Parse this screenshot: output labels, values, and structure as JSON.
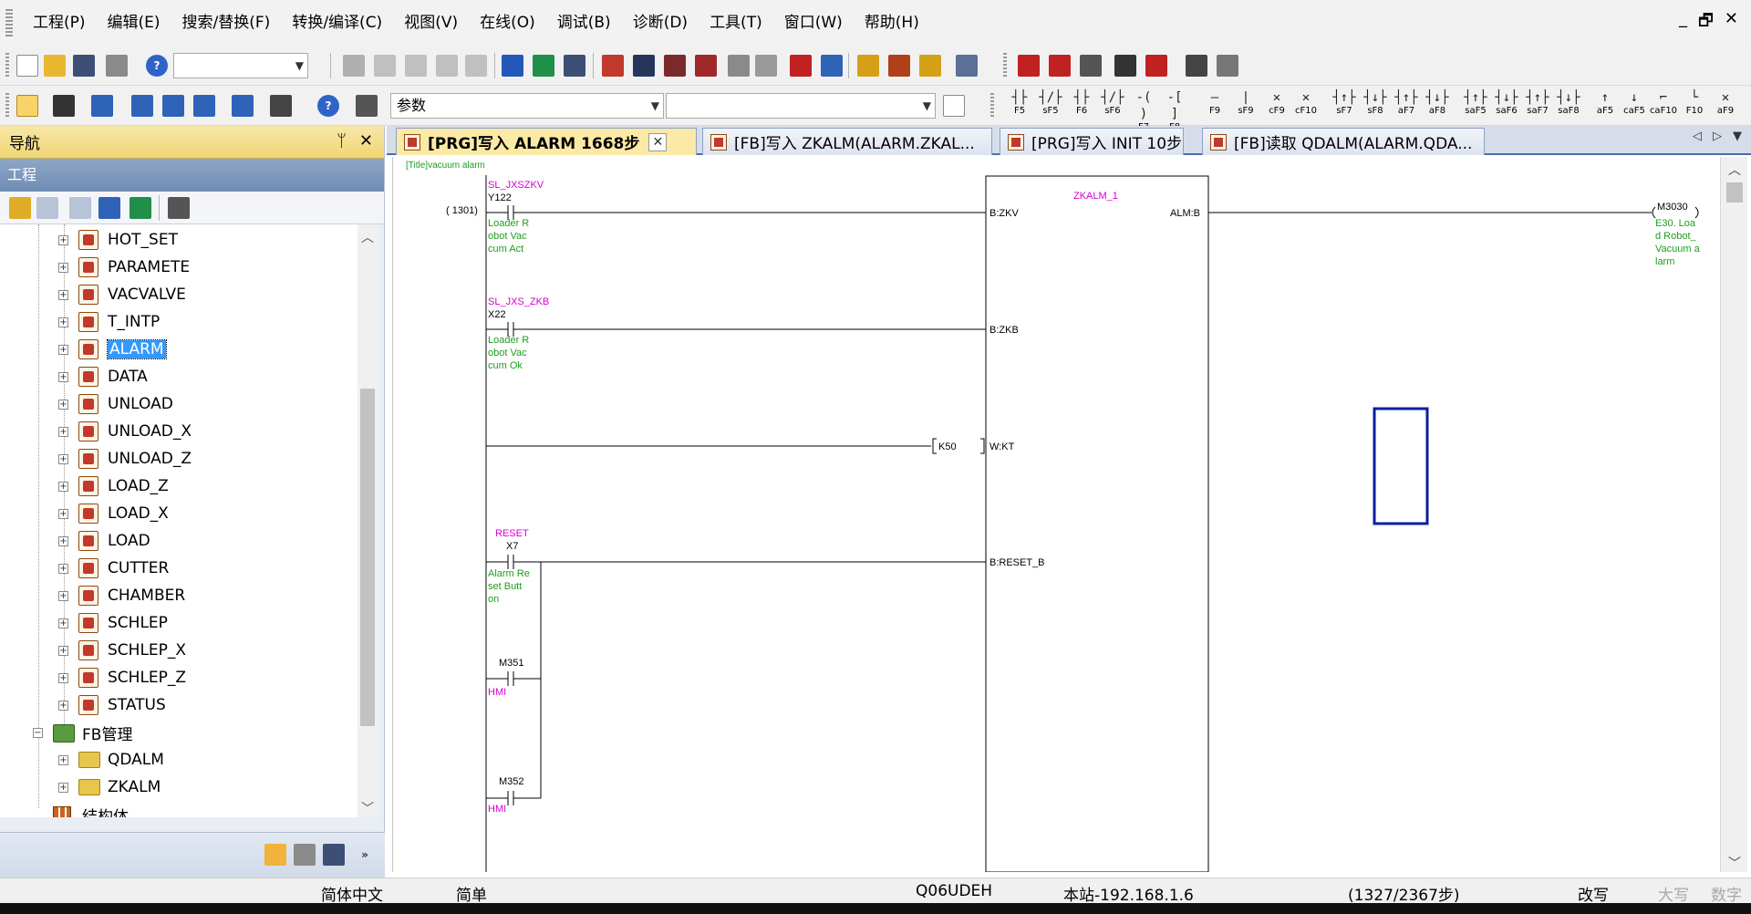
{
  "menu": {
    "items": [
      "工程(P)",
      "编辑(E)",
      "搜索/替换(F)",
      "转换/编译(C)",
      "视图(V)",
      "在线(O)",
      "调试(B)",
      "诊断(D)",
      "工具(T)",
      "窗口(W)",
      "帮助(H)"
    ],
    "window_controls": [
      "_",
      "🗗",
      "✕"
    ]
  },
  "toolbar": {
    "device_combo_value": "参数",
    "fkeys": [
      {
        "sym": "┤├",
        "label": "F5"
      },
      {
        "sym": "┤/├",
        "label": "sF5"
      },
      {
        "sym": "┤├",
        "label": "F6"
      },
      {
        "sym": "┤/├",
        "label": "sF6"
      },
      {
        "sym": "-( )",
        "label": "F7"
      },
      {
        "sym": "-[ ]",
        "label": "F8"
      },
      {
        "sym": "—",
        "label": "F9"
      },
      {
        "sym": "|",
        "label": "sF9"
      },
      {
        "sym": "✕",
        "label": "cF9"
      },
      {
        "sym": "✕",
        "label": "cF10"
      },
      {
        "sym": "┤↑├",
        "label": "sF7"
      },
      {
        "sym": "┤↓├",
        "label": "sF8"
      },
      {
        "sym": "┤↑├",
        "label": "aF7"
      },
      {
        "sym": "┤↓├",
        "label": "aF8"
      },
      {
        "sym": "┤↑├",
        "label": "saF5"
      },
      {
        "sym": "┤↓├",
        "label": "saF6"
      },
      {
        "sym": "┤↑├",
        "label": "saF7"
      },
      {
        "sym": "┤↓├",
        "label": "saF8"
      },
      {
        "sym": "↑",
        "label": "aF5"
      },
      {
        "sym": "↓",
        "label": "caF5"
      },
      {
        "sym": "⌐",
        "label": "caF10"
      },
      {
        "sym": "└",
        "label": "F10"
      },
      {
        "sym": "✕",
        "label": "aF9"
      }
    ]
  },
  "nav": {
    "title": "导航",
    "pin": "ᛘ",
    "close": "✕",
    "section": "工程",
    "tree": [
      {
        "label": "HOT_SET",
        "type": "prog",
        "level": 2,
        "expander": "+"
      },
      {
        "label": "PARAMETE",
        "type": "prog",
        "level": 2,
        "expander": "+"
      },
      {
        "label": "VACVALVE",
        "type": "prog",
        "level": 2,
        "expander": "+"
      },
      {
        "label": "T_INTP",
        "type": "prog",
        "level": 2,
        "expander": "+"
      },
      {
        "label": "ALARM",
        "type": "prog",
        "level": 2,
        "expander": "+",
        "selected": true
      },
      {
        "label": "DATA",
        "type": "prog",
        "level": 2,
        "expander": "+"
      },
      {
        "label": "UNLOAD",
        "type": "prog",
        "level": 2,
        "expander": "+"
      },
      {
        "label": "UNLOAD_X",
        "type": "prog",
        "level": 2,
        "expander": "+"
      },
      {
        "label": "UNLOAD_Z",
        "type": "prog",
        "level": 2,
        "expander": "+"
      },
      {
        "label": "LOAD_Z",
        "type": "prog",
        "level": 2,
        "expander": "+"
      },
      {
        "label": "LOAD_X",
        "type": "prog",
        "level": 2,
        "expander": "+"
      },
      {
        "label": "LOAD",
        "type": "prog",
        "level": 2,
        "expander": "+"
      },
      {
        "label": "CUTTER",
        "type": "prog",
        "level": 2,
        "expander": "+"
      },
      {
        "label": "CHAMBER",
        "type": "prog",
        "level": 2,
        "expander": "+"
      },
      {
        "label": "SCHLEP",
        "type": "prog",
        "level": 2,
        "expander": "+"
      },
      {
        "label": "SCHLEP_X",
        "type": "prog",
        "level": 2,
        "expander": "+"
      },
      {
        "label": "SCHLEP_Z",
        "type": "prog",
        "level": 2,
        "expander": "+"
      },
      {
        "label": "STATUS",
        "type": "prog",
        "level": 2,
        "expander": "+"
      },
      {
        "label": "FB管理",
        "type": "fbmgr",
        "level": 1,
        "expander": "−"
      },
      {
        "label": "QDALM",
        "type": "folder",
        "level": 2,
        "expander": "+"
      },
      {
        "label": "ZKALM",
        "type": "folder",
        "level": 2,
        "expander": "+"
      },
      {
        "label": "结构体",
        "type": "struct",
        "level": 1,
        "expander": ""
      }
    ]
  },
  "tabs": [
    {
      "label": "[PRG]写入 ALARM 1668步",
      "active": true,
      "close": "✕"
    },
    {
      "label": "[FB]写入 ZKALM(ALARM.ZKAL...",
      "active": false
    },
    {
      "label": "[PRG]写入 INIT 10步",
      "active": false
    },
    {
      "label": "[FB]读取 QDALM(ALARM.QDA...",
      "active": false
    }
  ],
  "ladder": {
    "title": "[Title]vacuum alarm",
    "step": "( 1301)",
    "contacts": [
      {
        "label": "SL_JXSZKV",
        "device": "Y122",
        "comment": [
          "Loader R",
          "obot Vac",
          "cum Act"
        ],
        "pin": "B:ZKV"
      },
      {
        "label": "SL_JXS_ZKB",
        "device": "X22",
        "comment": [
          "Loader R",
          "obot Vac",
          "cum Ok"
        ],
        "pin": "B:ZKB"
      },
      {
        "label": "RESET",
        "device": "X7",
        "comment": [
          "Alarm Re",
          "set Butt",
          "on"
        ],
        "pin": "B:RESET_B"
      },
      {
        "label": "",
        "device": "M351",
        "comment": [
          "HMI"
        ]
      },
      {
        "label": "",
        "device": "M352",
        "comment": [
          "HMI"
        ]
      }
    ],
    "constant": "K50",
    "constant_pin": "W:KT",
    "fb_instance": "ZKALM_1",
    "fb_output": "ALM:B",
    "coil": {
      "device": "M3030",
      "comment": [
        "E30. Loa",
        "d Robot_",
        "Vacuum a",
        "larm"
      ]
    },
    "colors": {
      "label": "#d400d4",
      "comment": "#1f9d1f",
      "cursor": "#0b1f9e",
      "device": "#000000"
    }
  },
  "status": {
    "lang": "简体中文",
    "mode": "简单",
    "cpu": "Q06UDEH",
    "station": "本站-192.168.1.6",
    "steps": "(1327/2367步)",
    "edit": "改写",
    "caps": "大写",
    "num": "数字"
  }
}
